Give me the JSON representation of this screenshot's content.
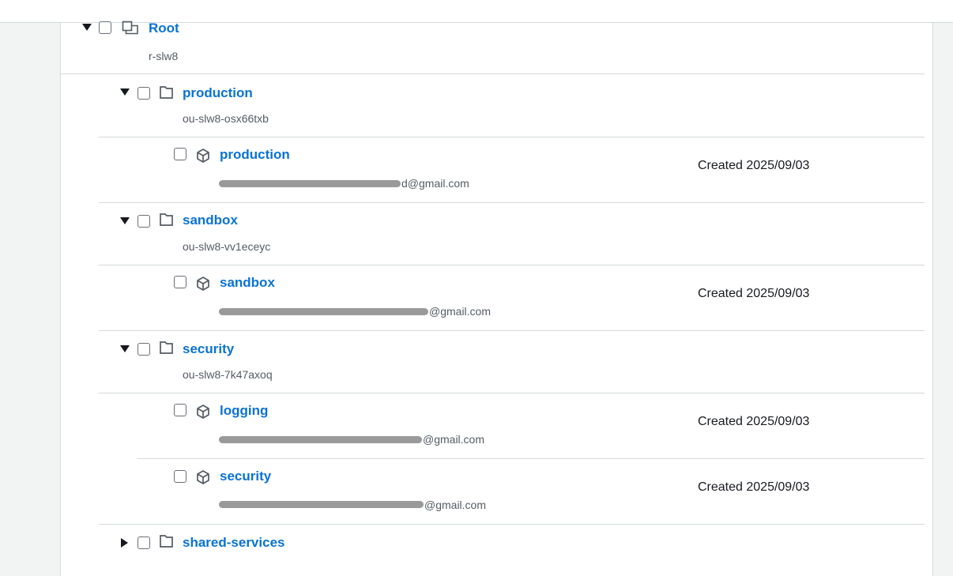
{
  "root": {
    "name": "Root",
    "id": "r-slw8"
  },
  "ous": [
    {
      "name": "production",
      "id": "ou-slw8-osx66txb",
      "accounts": [
        {
          "name": "production",
          "email_visible": "d@gmail.com",
          "created": "Created 2025/09/03"
        }
      ]
    },
    {
      "name": "sandbox",
      "id": "ou-slw8-vv1eceyc",
      "accounts": [
        {
          "name": "sandbox",
          "email_visible": "@gmail.com",
          "created": "Created 2025/09/03"
        }
      ]
    },
    {
      "name": "security",
      "id": "ou-slw8-7k47axoq",
      "accounts": [
        {
          "name": "logging",
          "email_visible": "@gmail.com",
          "created": "Created 2025/09/03"
        },
        {
          "name": "security",
          "email_visible": "@gmail.com",
          "created": "Created 2025/09/03"
        }
      ]
    },
    {
      "name": "shared-services",
      "id": "",
      "accounts": []
    }
  ],
  "icons": {
    "root": "root-org-icon",
    "ou": "folder-icon",
    "account": "cube-account-icon",
    "expand": "caret-down-icon",
    "collapse": "caret-right-icon"
  },
  "colors": {
    "link": "#0972d3",
    "text": "#16191f",
    "muted": "#545b64",
    "border": "#d5dbdb"
  }
}
